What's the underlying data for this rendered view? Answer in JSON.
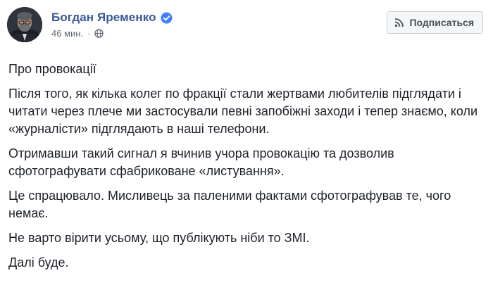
{
  "author": {
    "name": "Богдан Яременко",
    "verified": true
  },
  "meta": {
    "timestamp": "46 мин.",
    "separator": "·",
    "privacy_icon": "globe-icon"
  },
  "subscribe_button": {
    "label": "Подписаться",
    "icon": "rss-icon"
  },
  "post": {
    "paragraphs": [
      "Про провокації",
      "Після того, як кілька колег по фракції стали жертвами любителів підглядати і читати через плече ми застосували певні запобіжні заходи і тепер знаємо, коли «журналісти» підглядають в наші телефони.",
      "Отримавши такий сигнал я вчинив учора провокацію та дозволив сфотографувати сфабриковане «листування».",
      "Це спрацювало. Мисливець за паленими фактами сфотографував те, чого немає.",
      "Не варто вірити усьому, що публікують ніби то ЗМІ.",
      "Далі буде."
    ]
  },
  "colors": {
    "author_link": "#385898",
    "verified_badge": "#4080ff",
    "meta_text": "#616770",
    "body_text": "#1d2129",
    "button_bg": "#f5f6f7",
    "button_border": "#ced0d4"
  }
}
